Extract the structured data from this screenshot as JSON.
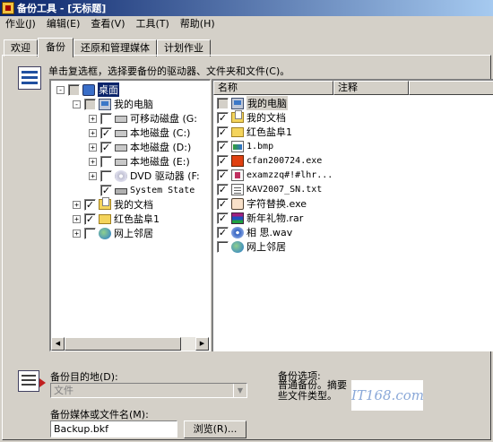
{
  "window": {
    "title": "备份工具 - [无标题]"
  },
  "menu": [
    "作业(J)",
    "编辑(E)",
    "查看(V)",
    "工具(T)",
    "帮助(H)"
  ],
  "tabs": [
    "欢迎",
    "备份",
    "还原和管理媒体",
    "计划作业"
  ],
  "active_tab": "备份",
  "instruction": "单击复选框，选择要备份的驱动器、文件夹和文件(C)。",
  "tree": [
    {
      "label": "桌面",
      "expander": "-",
      "checked": false,
      "grey": true,
      "icon": "desktop-icon"
    },
    {
      "label": "我的电脑",
      "expander": "-",
      "checked": false,
      "grey": true,
      "icon": "computer-icon"
    },
    {
      "label": "可移动磁盘 (G:",
      "expander": "+",
      "checked": false,
      "grey": false,
      "icon": "drive-icon"
    },
    {
      "label": "本地磁盘 (C:)",
      "expander": "+",
      "checked": true,
      "grey": false,
      "icon": "drive-icon"
    },
    {
      "label": "本地磁盘 (D:)",
      "expander": "+",
      "checked": true,
      "grey": false,
      "icon": "drive-icon"
    },
    {
      "label": "本地磁盘 (E:)",
      "expander": "+",
      "checked": false,
      "grey": false,
      "icon": "drive-icon"
    },
    {
      "label": "DVD 驱动器 (F:",
      "expander": "+",
      "checked": false,
      "grey": false,
      "icon": "cdrom-icon"
    },
    {
      "label": "System State",
      "expander": "",
      "checked": true,
      "grey": false,
      "icon": "system-state-icon"
    },
    {
      "label": "我的文档",
      "expander": "+",
      "checked": true,
      "grey": false,
      "icon": "documents-folder-icon"
    },
    {
      "label": "红色盐阜1",
      "expander": "+",
      "checked": true,
      "grey": false,
      "icon": "folder-icon"
    },
    {
      "label": "网上邻居",
      "expander": "+",
      "checked": false,
      "grey": false,
      "icon": "network-icon"
    }
  ],
  "list_columns": [
    "名称",
    "注释"
  ],
  "list_items": [
    {
      "name": "我的电脑",
      "checked": false,
      "grey": true,
      "icon": "computer-icon"
    },
    {
      "name": "我的文档",
      "checked": true,
      "grey": false,
      "icon": "documents-folder-icon"
    },
    {
      "name": "红色盐阜1",
      "checked": true,
      "grey": false,
      "icon": "folder-icon"
    },
    {
      "name": "1.bmp",
      "checked": true,
      "grey": false,
      "icon": "bitmap-file-icon"
    },
    {
      "name": "cfan200724.exe",
      "checked": true,
      "grey": false,
      "icon": "exe-file-icon"
    },
    {
      "name": "examzzq#!#lhr...",
      "checked": true,
      "grey": false,
      "icon": "exe-file-icon"
    },
    {
      "name": "KAV2007_SN.txt",
      "checked": true,
      "grey": false,
      "icon": "text-file-icon"
    },
    {
      "name": "字符替换.exe",
      "checked": true,
      "grey": false,
      "icon": "exe-file-icon"
    },
    {
      "name": "新年礼物.rar",
      "checked": true,
      "grey": false,
      "icon": "rar-archive-icon"
    },
    {
      "name": "相 思.wav",
      "checked": true,
      "grey": false,
      "icon": "audio-file-icon"
    },
    {
      "name": "网上邻居",
      "checked": false,
      "grey": false,
      "icon": "network-icon"
    }
  ],
  "destination": {
    "label": "备份目的地(D):",
    "value": "文件"
  },
  "media": {
    "label": "备份媒体或文件名(M):",
    "value": "Backup.bkf"
  },
  "browse_label": "浏览(R)...",
  "options": {
    "label": "备份选项:",
    "text": "普通备份。摘要 些文件类型。"
  },
  "watermark": "IT168.com"
}
